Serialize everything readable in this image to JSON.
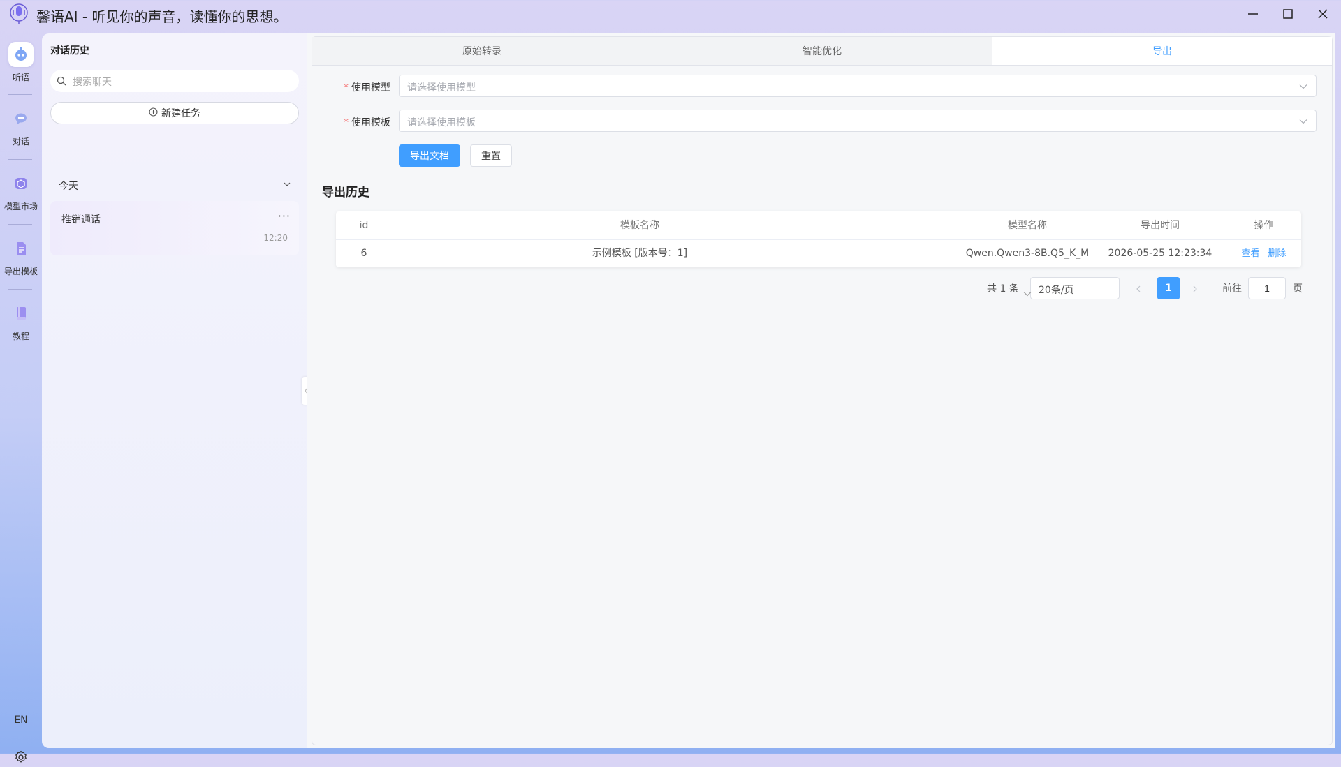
{
  "app": {
    "title": "馨语AI - 听见你的声音，读懂你的思想。"
  },
  "rail": {
    "items": [
      {
        "label": "听语"
      },
      {
        "label": "对话"
      },
      {
        "label": "模型市场"
      },
      {
        "label": "导出模板"
      },
      {
        "label": "教程"
      }
    ],
    "lang": "EN"
  },
  "history": {
    "title": "对话历史",
    "search_placeholder": "搜索聊天",
    "new_task": "新建任务",
    "group_label": "今天",
    "conversations": [
      {
        "title": "推销通话",
        "time": "12:20"
      }
    ]
  },
  "tabs": [
    {
      "label": "原始转录"
    },
    {
      "label": "智能优化"
    },
    {
      "label": "导出"
    }
  ],
  "form": {
    "model_label": "使用模型",
    "model_placeholder": "请选择使用模型",
    "template_label": "使用模板",
    "template_placeholder": "请选择使用模板",
    "export_button": "导出文档",
    "reset_button": "重置"
  },
  "export_history": {
    "title": "导出历史",
    "columns": [
      "id",
      "模板名称",
      "模型名称",
      "导出时间",
      "操作"
    ],
    "rows": [
      {
        "id": "6",
        "template": "示例模板 [版本号：1]",
        "model": "Qwen.Qwen3-8B.Q5_K_M",
        "time": "2026-05-25 12:23:34",
        "view": "查看",
        "delete": "删除"
      }
    ]
  },
  "pagination": {
    "total_text": "共 1 条",
    "page_size": "20条/页",
    "current_page": "1",
    "goto_label": "前往",
    "goto_value": "1",
    "page_suffix": "页"
  },
  "colors": {
    "accent": "#409eff",
    "required": "#f56c6c"
  }
}
